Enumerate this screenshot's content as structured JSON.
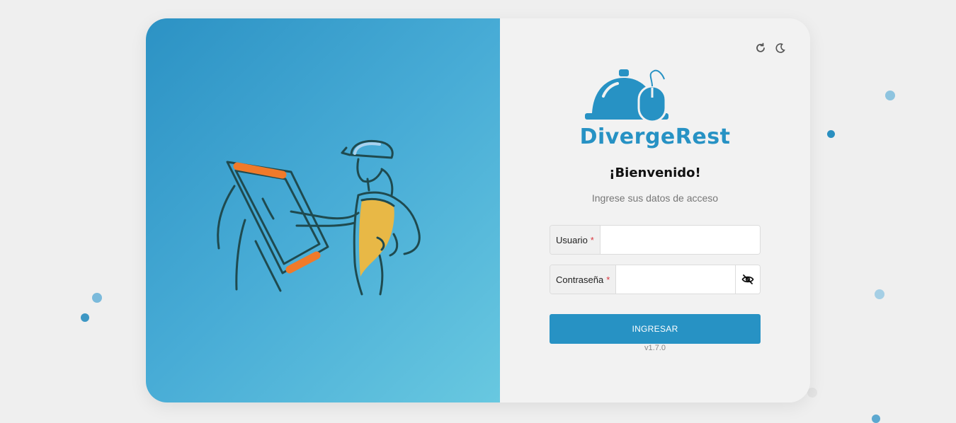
{
  "colors": {
    "brand": "#2792c4",
    "accent_orange": "#f07a2a",
    "accent_yellow": "#f5b83a",
    "required": "#d9363e"
  },
  "header_icons": [
    "refresh-icon",
    "moon-icon"
  ],
  "brand": {
    "name": "DivergeRest",
    "logo_icon": "cloche-mouse-icon"
  },
  "login": {
    "title": "¡Bienvenido!",
    "subtitle": "Ingrese sus datos de acceso",
    "username": {
      "label": "Usuario",
      "required_mark": "*",
      "value": "",
      "placeholder": ""
    },
    "password": {
      "label": "Contraseña",
      "required_mark": "*",
      "value": "",
      "placeholder": "",
      "toggle_icon": "eye-off-icon"
    },
    "submit_label": "INGRESAR",
    "version": "v1.7.0"
  }
}
